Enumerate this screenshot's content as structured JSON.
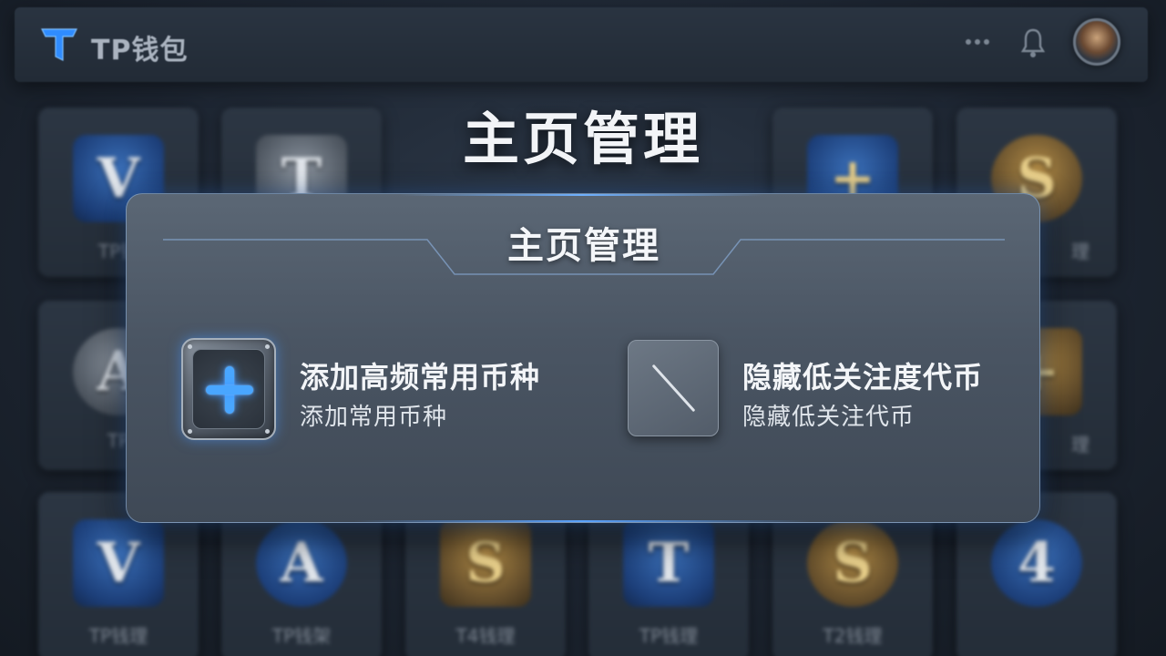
{
  "header": {
    "brand": "TP钱包",
    "logo_icon": "tp-logo-icon",
    "icons": [
      "more-icon",
      "bell-icon",
      "avatar"
    ]
  },
  "page_title": "主页管理",
  "background_tiles": [
    {
      "glyph": "V",
      "label": "TP钱"
    },
    {
      "glyph": "T",
      "label": ""
    },
    {
      "glyph": "+",
      "label": ""
    },
    {
      "glyph": "S",
      "label": "理"
    },
    {
      "glyph": "A",
      "label": "TP"
    },
    {
      "glyph": "+",
      "label": "理"
    },
    {
      "glyph": "V",
      "label": "TP钱理"
    },
    {
      "glyph": "A",
      "label": "TP钱架"
    },
    {
      "glyph": "S",
      "label": "T4钱理"
    },
    {
      "glyph": "T",
      "label": "TP钱理"
    },
    {
      "glyph": "S",
      "label": "T2钱理"
    },
    {
      "glyph": "4",
      "label": ""
    }
  ],
  "modal": {
    "title": "主页管理",
    "options": [
      {
        "title": "添加高频常用币种",
        "subtitle": "添加常用币种",
        "icon": "plus-icon"
      },
      {
        "title": "隐藏低关注度代币",
        "subtitle": "隐藏低关注代币",
        "icon": "slash-icon"
      }
    ]
  },
  "colors": {
    "accent": "#49a6ff",
    "background": "#1c2430",
    "modal": "#4a5563"
  }
}
